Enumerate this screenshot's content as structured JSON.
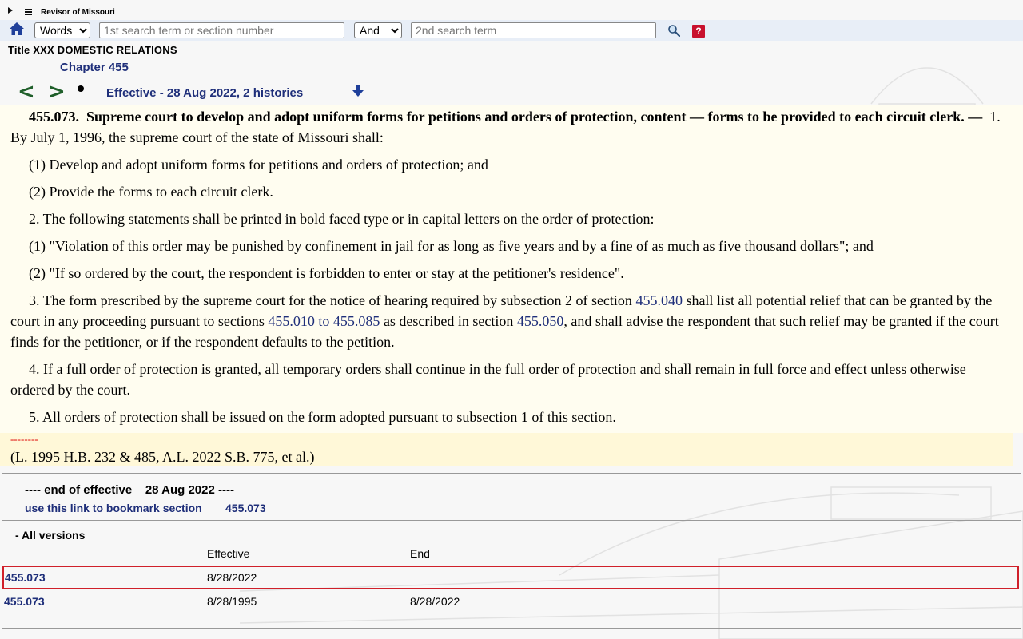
{
  "topbar": {
    "site_title": "Revisor of Missouri"
  },
  "search": {
    "mode_selected": "Words",
    "term1_placeholder": "1st search term or section number",
    "operator_selected": "And",
    "term2_placeholder": "2nd search term",
    "help_label": "?"
  },
  "header": {
    "title": "Title XXX DOMESTIC RELATIONS",
    "chapter": "Chapter 455"
  },
  "nav": {
    "prev_label": "<",
    "next_label": ">",
    "effective_text": "Effective - 28 Aug 2022, 2 histories"
  },
  "section": {
    "heading_num": "455.073.",
    "heading_title": "Supreme court to develop and adopt uniform forms for petitions and orders of protection, content — forms to be provided to each circuit clerk. —",
    "p1": "1.  By July 1, 1996, the supreme court of the state of Missouri shall:",
    "p1_item1": "(1)  Develop and adopt uniform forms for petitions and orders of protection; and",
    "p1_item2": "(2)  Provide the forms to each circuit clerk.",
    "p2": "2.  The following statements shall be printed in bold faced type or in capital letters on the order of protection:",
    "p2_item1": "(1)  \"Violation of this order may be punished by confinement in jail for as long as five years and by a fine of as much as five thousand dollars\"; and",
    "p2_item2": "(2)  \"If so ordered by the court, the respondent is forbidden to enter or stay at the petitioner's residence\".",
    "p3_a": "3.  The form prescribed by the supreme court for the notice of hearing required by subsection 2 of section",
    "p3_link1": "455.040",
    "p3_b": "shall list all potential relief that can be granted by the court in any proceeding pursuant to sections",
    "p3_link2": "455.010 to 455.085",
    "p3_c": "as described in section",
    "p3_link3": "455.050",
    "p3_d": ", and shall advise the respondent that such relief may be granted if the court finds for the petitioner, or if the respondent defaults to the petition.",
    "p4": "4.  If a full order of protection is granted, all temporary orders shall continue in the full order of protection and shall remain in full force and effect unless otherwise ordered by the court.",
    "p5": "5.  All orders of protection shall be issued on the form adopted pursuant to subsection 1 of this section."
  },
  "history": {
    "separator": "--------",
    "text": "(L. 1995 H.B. 232 & 485, A.L. 2022 S.B. 775, et al.)"
  },
  "footer": {
    "end_text": "---- end of effective    28 Aug 2022 ----",
    "bookmark_label": "use this link to bookmark section",
    "bookmark_section": "455.073"
  },
  "versions": {
    "toggle_label": "- All versions",
    "col_effective": "Effective",
    "col_end": "End",
    "rows": [
      {
        "section": "455.073",
        "effective": "8/28/2022",
        "end": ""
      },
      {
        "section": "455.073",
        "effective": "8/28/1995",
        "end": "8/28/2022"
      }
    ]
  },
  "colors": {
    "link": "#1f2f7a",
    "nav_arrow": "#1f5f2a",
    "highlight_border": "#d0202a",
    "content_bg": "#fffdf0"
  },
  "icons": [
    "home-icon",
    "search-icon",
    "help-icon",
    "down-arrow-icon",
    "prev-arrow-icon",
    "next-arrow-icon",
    "menu-icon"
  ]
}
